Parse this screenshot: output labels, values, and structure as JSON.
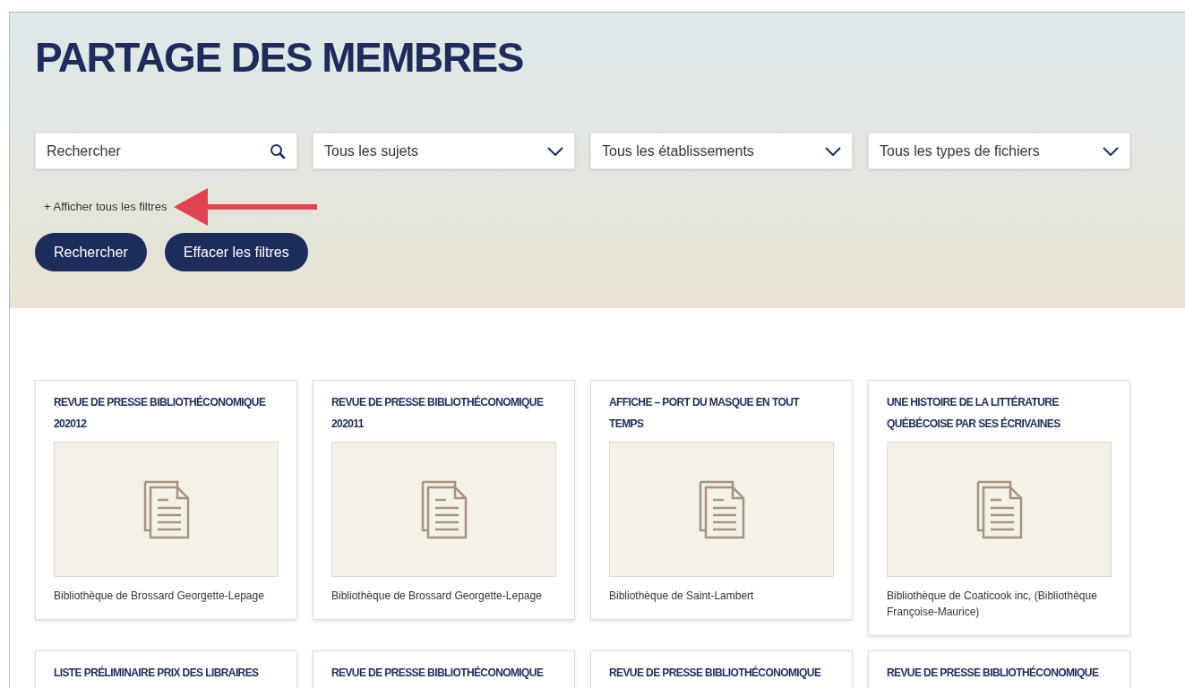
{
  "page": {
    "title": "PARTAGE DES MEMBRES"
  },
  "filters": [
    {
      "kind": "search",
      "placeholder": "Rechercher"
    },
    {
      "kind": "select",
      "value": "Tous les sujets"
    },
    {
      "kind": "select",
      "value": "Tous les établissements"
    },
    {
      "kind": "select",
      "value": "Tous les types de fichiers"
    }
  ],
  "toggle_filters": "+ Afficher tous les filtres",
  "buttons": [
    "Rechercher",
    "Effacer les filtres"
  ],
  "cards": [
    {
      "title": "REVUE DE PRESSE BIBLIOTHÉCONOMIQUE 202012",
      "library": "Bibliothèque de Brossard Georgette-Lepage"
    },
    {
      "title": "REVUE DE PRESSE BIBLIOTHÉCONOMIQUE 202011",
      "library": "Bibliothèque de Brossard Georgette-Lepage"
    },
    {
      "title": "AFFICHE – PORT DU MASQUE EN TOUT TEMPS",
      "library": "Bibliothèque de Saint-Lambert"
    },
    {
      "title": "UNE HISTOIRE DE LA LITTÉRATURE QUÉBÉCOISE PAR SES ÉCRIVAINES",
      "library": "Bibliothèque de Coaticook inc, (Bibliothèque Françoise-Maurice)"
    },
    {
      "title": "LISTE PRÉLIMINAIRE PRIX DES LIBRAIRES"
    },
    {
      "title": "REVUE DE PRESSE BIBLIOTHÉCONOMIQUE"
    },
    {
      "title": "REVUE DE PRESSE BIBLIOTHÉCONOMIQUE"
    },
    {
      "title": "REVUE DE PRESSE BIBLIOTHÉCONOMIQUE"
    }
  ]
}
